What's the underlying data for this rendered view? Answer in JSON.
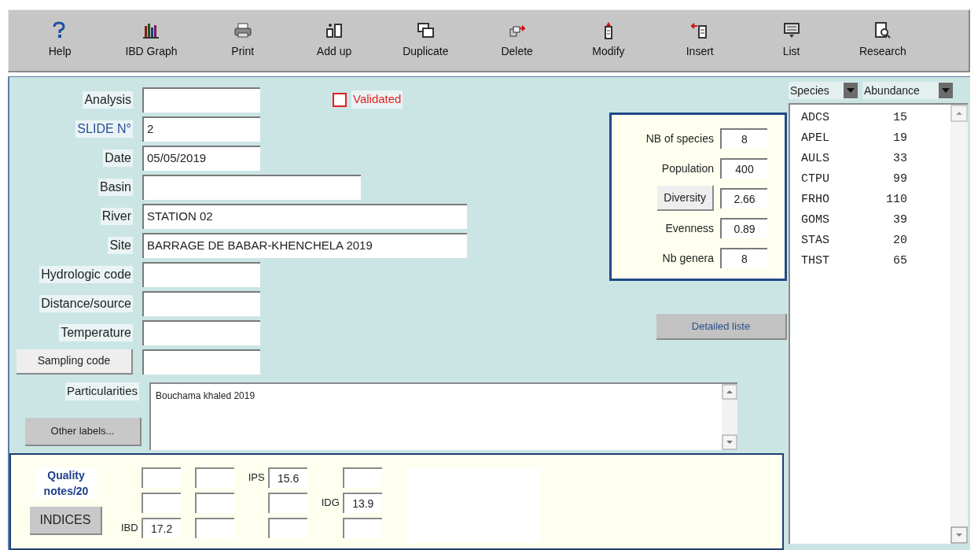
{
  "toolbar": [
    {
      "label": "Help"
    },
    {
      "label": "IBD Graph"
    },
    {
      "label": "Print"
    },
    {
      "label": "Add up"
    },
    {
      "label": "Duplicate"
    },
    {
      "label": "Delete"
    },
    {
      "label": "Modify"
    },
    {
      "label": "Insert"
    },
    {
      "label": "List"
    },
    {
      "label": "Research"
    }
  ],
  "form": {
    "fields": [
      {
        "label": "Analysis",
        "kind": "label",
        "color": "#222222"
      },
      {
        "label": "SLIDE N°",
        "kind": "label",
        "color": "#2a4f9a",
        "value": "2"
      },
      {
        "label": "Date",
        "kind": "label",
        "color": "#222222",
        "value": "05/05/2019"
      },
      {
        "label": "Basin",
        "kind": "label",
        "color": "#222222"
      },
      {
        "label": "River",
        "kind": "label",
        "color": "#222222",
        "value": "STATION 02"
      },
      {
        "label": "Site",
        "kind": "label",
        "color": "#222222",
        "value": "BARRAGE DE BABAR-KHENCHELA 2019"
      },
      {
        "label": "Hydrologic code",
        "kind": "label",
        "color": "#222222"
      },
      {
        "label": "Distance/source",
        "kind": "label",
        "color": "#222222"
      },
      {
        "label": "Temperature",
        "kind": "label",
        "color": "#222222"
      },
      {
        "label": "Sampling code",
        "kind": "button",
        "color": "#222222"
      }
    ],
    "validated": {
      "label": "Validated",
      "checked": false
    }
  },
  "stats": {
    "rows": [
      {
        "label": "NB of species",
        "kind": "label",
        "value": "8"
      },
      {
        "label": "Population",
        "kind": "label",
        "value": "400"
      },
      {
        "label": "Diversity",
        "kind": "button",
        "value": "2.66"
      },
      {
        "label": "Evenness",
        "kind": "label",
        "value": "0.89"
      },
      {
        "label": "Nb genera",
        "kind": "label",
        "value": "8"
      }
    ],
    "detail_button": "Detailed liste"
  },
  "particularities": {
    "label": "Particularities",
    "value": "Bouchama khaled 2019",
    "button": "Other labels..."
  },
  "quality": {
    "title": "Quality notes/20",
    "button": "INDICES",
    "columns": [
      {
        "cells": [
          {},
          {},
          {
            "label": "IBD",
            "value": "17.2"
          }
        ]
      },
      {
        "cells": [
          {},
          {},
          {}
        ]
      },
      {
        "cells": [
          {
            "label": "IPS",
            "value": "15.6"
          },
          {},
          {}
        ]
      },
      {
        "cells": [
          {},
          {
            "label": "IDG",
            "value": "13.9"
          },
          {}
        ]
      }
    ]
  },
  "species": {
    "headers": [
      "Species",
      "Abundance"
    ],
    "rows": [
      {
        "code": "ADCS",
        "count": "15"
      },
      {
        "code": "APEL",
        "count": "19"
      },
      {
        "code": "AULS",
        "count": "33"
      },
      {
        "code": "CTPU",
        "count": "99"
      },
      {
        "code": "FRHO",
        "count": "110"
      },
      {
        "code": "GOMS",
        "count": "39"
      },
      {
        "code": "STAS",
        "count": "20"
      },
      {
        "code": "THST",
        "count": "65"
      }
    ]
  }
}
